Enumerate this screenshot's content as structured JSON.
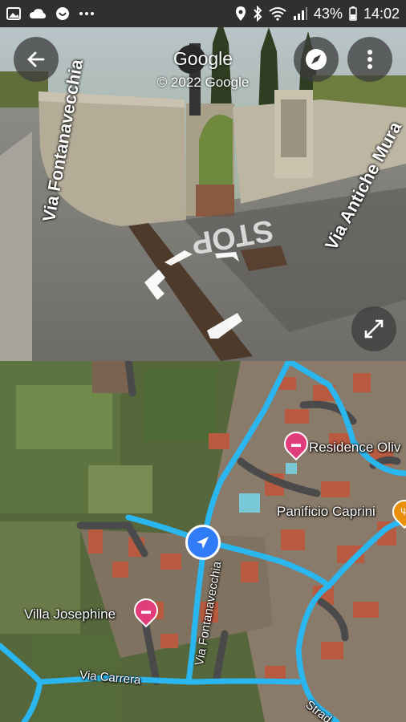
{
  "status_bar": {
    "battery": "43%",
    "time": "14:02",
    "left_icons": [
      "gallery-icon",
      "cloud-icon",
      "whatsapp-icon",
      "more-dots-icon"
    ],
    "right_icons": [
      "location-icon",
      "bluetooth-icon",
      "wifi-icon",
      "signal-icon"
    ]
  },
  "street_view": {
    "title": "Google",
    "copyright": "© 2022 Google",
    "street_labels": [
      "Via Fontanavecchia",
      "Via Antiche Mura"
    ],
    "road_text": "STOP",
    "buttons": [
      "back-arrow-icon",
      "compass-icon",
      "more-vert-icon",
      "fullscreen-icon"
    ]
  },
  "map": {
    "places": [
      {
        "name": "Residence Oliv",
        "icon": "bed-icon",
        "color": "#e23d7b"
      },
      {
        "name": "Panificio Caprini",
        "icon": "fork-knife-icon",
        "color": "#e8900c"
      },
      {
        "name": "Villa Josephine",
        "icon": "bed-icon",
        "color": "#e23d7b"
      }
    ],
    "street_labels": [
      "Via Fontanavecchia",
      "Via Carrera",
      "Strad"
    ],
    "route_color": "#2ab6ee",
    "location_marker_color": "#2f7cf6"
  }
}
